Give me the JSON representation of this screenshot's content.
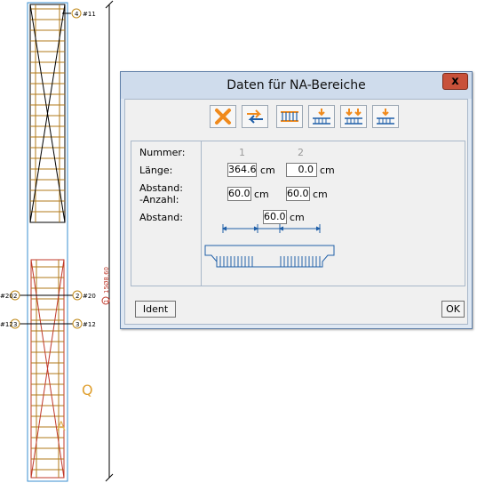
{
  "drawing": {
    "markers_left": [
      {
        "id": "4",
        "label": "#11"
      },
      {
        "id": "2",
        "label": "#20"
      },
      {
        "id": "3",
        "label": "#12"
      }
    ],
    "markers_right": [
      {
        "id": "2",
        "label": "#20"
      },
      {
        "id": "3",
        "label": "#12"
      }
    ],
    "dimension": {
      "id": "1",
      "label": "15Ø8,60"
    },
    "letter_q": "Q",
    "letter_a": "A"
  },
  "dialog": {
    "title": "Daten für NA-Bereiche",
    "close_label": "x",
    "toolbar": [
      {
        "icon": "delete-icon"
      },
      {
        "icon": "swap-icon"
      },
      {
        "icon": "stirrup-add-icon"
      },
      {
        "icon": "stirrup-insert-icon"
      },
      {
        "icon": "stirrup-double-icon"
      },
      {
        "icon": "stirrup-single-icon"
      }
    ],
    "labels": {
      "nummer": "Nummer:",
      "laenge": "Länge:",
      "abstand_anzahl_1": "Abstand:",
      "abstand_anzahl_2": "-Anzahl:",
      "abstand": "Abstand:"
    },
    "columns": [
      {
        "nummer": "1",
        "laenge": "364.6",
        "abstand": "60.0"
      },
      {
        "nummer": "2",
        "laenge": "0.0",
        "abstand": "60.0"
      }
    ],
    "unit": "cm",
    "abstand_value": "60.0",
    "ident_label": "Ident",
    "ok_label": "OK",
    "colors": {
      "accent": "#f08a1c",
      "stirrup_blue": "#1f5fa8",
      "close_red": "#c8513a"
    }
  }
}
